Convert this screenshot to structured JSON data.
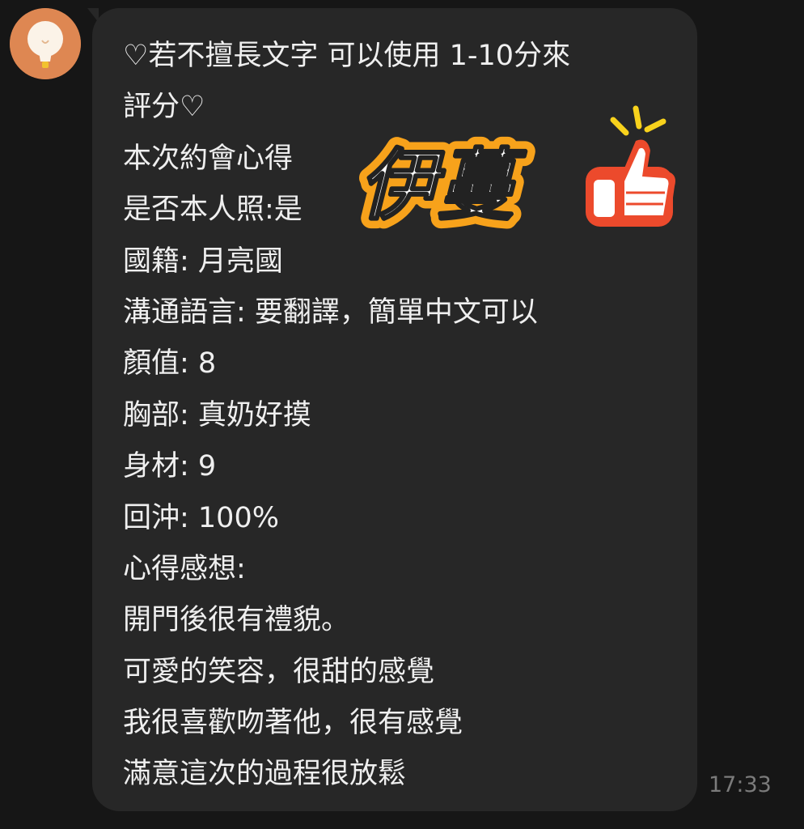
{
  "message": {
    "lines": [
      "♡若不擅長文字 可以使用 1-10分來",
      "評分♡",
      "本次約會心得",
      "是否本人照:是",
      "國籍: 月亮國",
      "溝通語言: 要翻譯，簡單中文可以",
      "顏值: 8",
      "胸部: 真奶好摸",
      "身材: 9",
      "回沖: 100%",
      "心得感想:",
      "開門後很有禮貌。",
      "可愛的笑容，很甜的感覺",
      "我很喜歡吻著他，很有感覺",
      "滿意這次的過程很放鬆"
    ],
    "timestamp": "17:33"
  },
  "sticker": {
    "text": "伊蔓",
    "icon": "thumbs-up-icon"
  },
  "avatar": {
    "icon": "lightbulb-avatar-icon",
    "color": "#de8752"
  },
  "colors": {
    "background": "#161616",
    "bubble": "#272727",
    "text": "#efefef",
    "timestamp": "#7b7b7b",
    "sticker_fill": "#ffffff",
    "sticker_outline": "#f7a21b",
    "thumb_red": "#ec4a2c",
    "spark_yellow": "#f8d21c"
  }
}
